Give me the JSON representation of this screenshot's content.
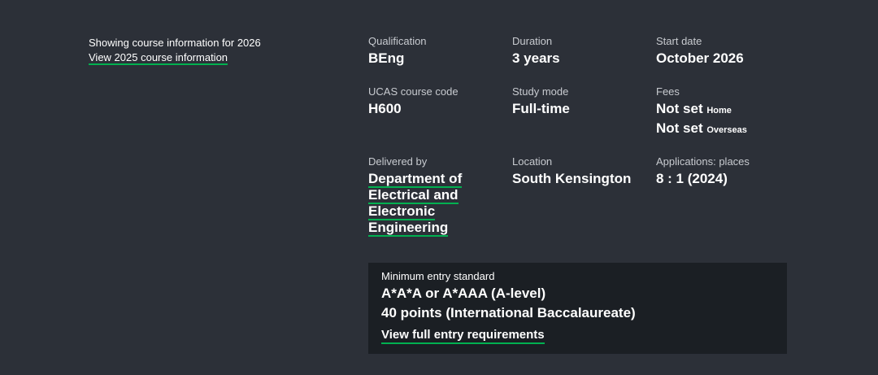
{
  "year_info": {
    "showing_text": "Showing course information for 2026",
    "other_year_link": "View 2025 course information"
  },
  "facts": {
    "qualification": {
      "label": "Qualification",
      "value": "BEng"
    },
    "duration": {
      "label": "Duration",
      "value": "3 years"
    },
    "start_date": {
      "label": "Start date",
      "value": "October 2026"
    },
    "ucas_code": {
      "label": "UCAS course code",
      "value": "H600"
    },
    "study_mode": {
      "label": "Study mode",
      "value": "Full-time"
    },
    "fees": {
      "label": "Fees",
      "home_value": "Not set",
      "home_suffix": "Home",
      "overseas_value": "Not set",
      "overseas_suffix": "Overseas"
    },
    "delivered_by": {
      "label": "Delivered by",
      "lines": [
        "Department of",
        "Electrical and",
        "Electronic",
        "Engineering"
      ]
    },
    "location": {
      "label": "Location",
      "value": "South Kensington"
    },
    "applications": {
      "label": "Applications: places",
      "value": "8 : 1 (2024)"
    }
  },
  "entry": {
    "label": "Minimum entry standard",
    "a_level": "A*A*A or A*AAA (A-level)",
    "ib": "40 points (International Baccalaureate)",
    "link": "View full entry requirements"
  },
  "colors": {
    "background": "#2c3038",
    "entry_box": "#1b1f24",
    "link_underline": "#00b050"
  }
}
